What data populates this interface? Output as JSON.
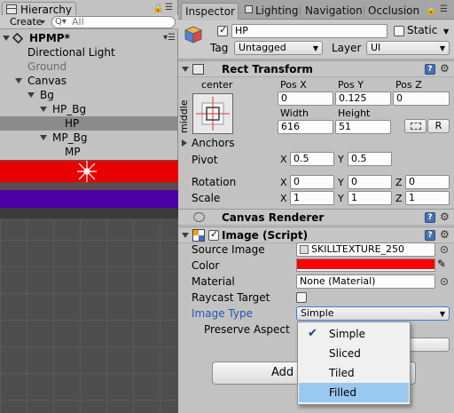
{
  "hierarchy": {
    "tab_label": "Hierarchy",
    "create_label": "Create",
    "search_placeholder": "All",
    "scene_name": "HPMP*",
    "items": [
      {
        "label": "Directional Light",
        "muted": false
      },
      {
        "label": "Ground",
        "muted": true
      },
      {
        "label": "Canvas",
        "muted": false
      },
      {
        "label": "Bg",
        "muted": false
      },
      {
        "label": "HP_Bg",
        "muted": false
      },
      {
        "label": "HP",
        "muted": false,
        "selected": true
      },
      {
        "label": "MP_Bg",
        "muted": false
      },
      {
        "label": "MP",
        "muted": false
      }
    ]
  },
  "scene": {
    "hp_bar_color": "#e90000",
    "mp_bar_color": "#4b00a8"
  },
  "inspector": {
    "tabs": [
      "Inspector",
      "Lighting",
      "Navigation",
      "Occlusion"
    ],
    "gameobject": {
      "name": "HP",
      "static_label": "Static",
      "tag_label": "Tag",
      "tag_value": "Untagged",
      "layer_label": "Layer",
      "layer_value": "UI"
    },
    "rect_transform": {
      "title": "Rect Transform",
      "anchor_h": "center",
      "anchor_v": "middle",
      "pos_x_label": "Pos X",
      "pos_y_label": "Pos Y",
      "pos_z_label": "Pos Z",
      "pos_x": "0",
      "pos_y": "0.125",
      "pos_z": "0",
      "width_label": "Width",
      "height_label": "Height",
      "width": "616",
      "height": "51",
      "r_button": "R",
      "anchors_label": "Anchors",
      "pivot_label": "Pivot",
      "pivot_x": "0.5",
      "pivot_y": "0.5",
      "rotation_label": "Rotation",
      "rot_x": "0",
      "rot_y": "0",
      "rot_z": "0",
      "scale_label": "Scale",
      "scale_x": "1",
      "scale_y": "1",
      "scale_z": "1",
      "x": "X",
      "y": "Y",
      "z": "Z"
    },
    "canvas_renderer": {
      "title": "Canvas Renderer"
    },
    "image": {
      "title": "Image (Script)",
      "source_image_label": "Source Image",
      "source_image_value": "SKILLTEXTURE_250",
      "color_label": "Color",
      "color_value": "#ff0000",
      "material_label": "Material",
      "material_value": "None (Material)",
      "raycast_label": "Raycast Target",
      "image_type_label": "Image Type",
      "image_type_value": "Simple",
      "preserve_aspect_label": "Preserve Aspect"
    },
    "dropdown_options": [
      {
        "label": "Simple",
        "checked": true,
        "highlighted": false
      },
      {
        "label": "Sliced",
        "checked": false,
        "highlighted": false
      },
      {
        "label": "Tiled",
        "checked": false,
        "highlighted": false
      },
      {
        "label": "Filled",
        "checked": false,
        "highlighted": true
      }
    ],
    "add_component_label": "Add C"
  }
}
